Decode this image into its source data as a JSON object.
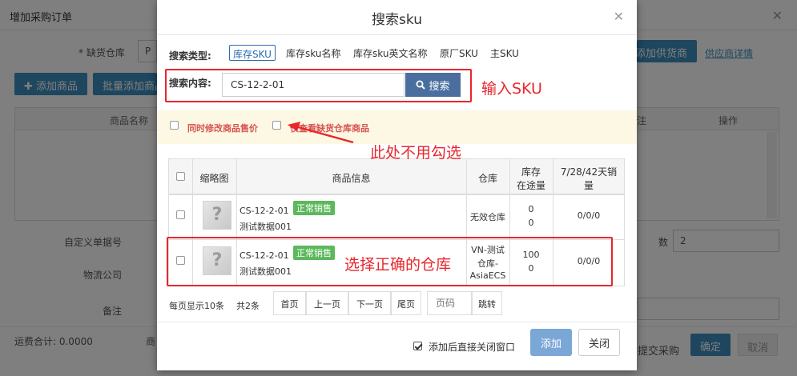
{
  "background": {
    "title": "增加采购订单",
    "warehouse_label": "* 缺货仓库",
    "warehouse_value": "P",
    "add_product": "添加商品",
    "batch_add": "批量添加商品",
    "add_supplier": "添加供货商",
    "supplier_detail": "供应商详情",
    "col_product": "商品名称",
    "col_extra": "注",
    "col_action": "操作",
    "custom_order_label": "自定义单据号",
    "logistics_label": "物流公司",
    "remark_label": "备注",
    "freight_label": "运费合计: 0.0000",
    "merchant_label": "商",
    "count_label": "数",
    "count_value": "2",
    "submit_purchase": "提交采购",
    "confirm": "确定",
    "cancel": "取消"
  },
  "modal": {
    "title": "搜索sku",
    "search_type_label": "搜索类型:",
    "search_types": [
      "库存SKU",
      "库存sku名称",
      "库存sku英文名称",
      "原厂SKU",
      "主SKU"
    ],
    "search_content_label": "搜索内容:",
    "search_value": "CS-12-2-01",
    "search_button": "搜索",
    "option_modify_price": "同时修改商品售价",
    "option_only_shortage": "仅查看缺货仓库商品",
    "table": {
      "headers": {
        "thumbnail": "缩略图",
        "product_info": "商品信息",
        "warehouse": "仓库",
        "stock_line1": "库存",
        "stock_line2": "在途量",
        "sales_line1": "7/28/42天销",
        "sales_line2": "量"
      },
      "rows": [
        {
          "sku": "CS-12-2-01",
          "status": "正常销售",
          "name": "测试数据001",
          "warehouse": "无效仓库",
          "stock": "0",
          "in_transit": "0",
          "sales": "0/0/0"
        },
        {
          "sku": "CS-12-2-01",
          "status": "正常销售",
          "name": "测试数据001",
          "warehouse_line1": "VN-测试",
          "warehouse_line2": "仓库-",
          "warehouse_line3": "AsiaECS",
          "stock": "100",
          "in_transit": "0",
          "sales": "0/0/0"
        }
      ]
    },
    "pagination": {
      "per_page": "每页显示10条",
      "total": "共2条",
      "first": "首页",
      "prev": "上一页",
      "next": "下一页",
      "last": "尾页",
      "page_placeholder": "页码",
      "jump": "跳转"
    },
    "close_after_add": "添加后直接关闭窗口",
    "add_button": "添加",
    "close_button": "关闭"
  },
  "annotations": {
    "input_sku": "输入SKU",
    "no_check": "此处不用勾选",
    "select_warehouse": "选择正确的仓库"
  },
  "colors": {
    "annotation_red": "#e8262c",
    "primary_blue": "#4a6f9e",
    "status_green": "#5cb85c",
    "warning_bg": "#fcf8e3"
  }
}
